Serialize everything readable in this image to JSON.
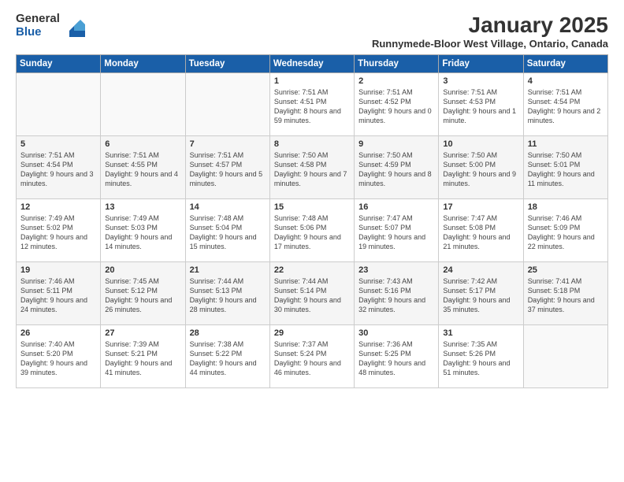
{
  "logo": {
    "general": "General",
    "blue": "Blue"
  },
  "title": "January 2025",
  "location": "Runnymede-Bloor West Village, Ontario, Canada",
  "days_of_week": [
    "Sunday",
    "Monday",
    "Tuesday",
    "Wednesday",
    "Thursday",
    "Friday",
    "Saturday"
  ],
  "weeks": [
    [
      {
        "day": "",
        "info": ""
      },
      {
        "day": "",
        "info": ""
      },
      {
        "day": "",
        "info": ""
      },
      {
        "day": "1",
        "info": "Sunrise: 7:51 AM\nSunset: 4:51 PM\nDaylight: 8 hours and 59 minutes."
      },
      {
        "day": "2",
        "info": "Sunrise: 7:51 AM\nSunset: 4:52 PM\nDaylight: 9 hours and 0 minutes."
      },
      {
        "day": "3",
        "info": "Sunrise: 7:51 AM\nSunset: 4:53 PM\nDaylight: 9 hours and 1 minute."
      },
      {
        "day": "4",
        "info": "Sunrise: 7:51 AM\nSunset: 4:54 PM\nDaylight: 9 hours and 2 minutes."
      }
    ],
    [
      {
        "day": "5",
        "info": "Sunrise: 7:51 AM\nSunset: 4:54 PM\nDaylight: 9 hours and 3 minutes."
      },
      {
        "day": "6",
        "info": "Sunrise: 7:51 AM\nSunset: 4:55 PM\nDaylight: 9 hours and 4 minutes."
      },
      {
        "day": "7",
        "info": "Sunrise: 7:51 AM\nSunset: 4:57 PM\nDaylight: 9 hours and 5 minutes."
      },
      {
        "day": "8",
        "info": "Sunrise: 7:50 AM\nSunset: 4:58 PM\nDaylight: 9 hours and 7 minutes."
      },
      {
        "day": "9",
        "info": "Sunrise: 7:50 AM\nSunset: 4:59 PM\nDaylight: 9 hours and 8 minutes."
      },
      {
        "day": "10",
        "info": "Sunrise: 7:50 AM\nSunset: 5:00 PM\nDaylight: 9 hours and 9 minutes."
      },
      {
        "day": "11",
        "info": "Sunrise: 7:50 AM\nSunset: 5:01 PM\nDaylight: 9 hours and 11 minutes."
      }
    ],
    [
      {
        "day": "12",
        "info": "Sunrise: 7:49 AM\nSunset: 5:02 PM\nDaylight: 9 hours and 12 minutes."
      },
      {
        "day": "13",
        "info": "Sunrise: 7:49 AM\nSunset: 5:03 PM\nDaylight: 9 hours and 14 minutes."
      },
      {
        "day": "14",
        "info": "Sunrise: 7:48 AM\nSunset: 5:04 PM\nDaylight: 9 hours and 15 minutes."
      },
      {
        "day": "15",
        "info": "Sunrise: 7:48 AM\nSunset: 5:06 PM\nDaylight: 9 hours and 17 minutes."
      },
      {
        "day": "16",
        "info": "Sunrise: 7:47 AM\nSunset: 5:07 PM\nDaylight: 9 hours and 19 minutes."
      },
      {
        "day": "17",
        "info": "Sunrise: 7:47 AM\nSunset: 5:08 PM\nDaylight: 9 hours and 21 minutes."
      },
      {
        "day": "18",
        "info": "Sunrise: 7:46 AM\nSunset: 5:09 PM\nDaylight: 9 hours and 22 minutes."
      }
    ],
    [
      {
        "day": "19",
        "info": "Sunrise: 7:46 AM\nSunset: 5:11 PM\nDaylight: 9 hours and 24 minutes."
      },
      {
        "day": "20",
        "info": "Sunrise: 7:45 AM\nSunset: 5:12 PM\nDaylight: 9 hours and 26 minutes."
      },
      {
        "day": "21",
        "info": "Sunrise: 7:44 AM\nSunset: 5:13 PM\nDaylight: 9 hours and 28 minutes."
      },
      {
        "day": "22",
        "info": "Sunrise: 7:44 AM\nSunset: 5:14 PM\nDaylight: 9 hours and 30 minutes."
      },
      {
        "day": "23",
        "info": "Sunrise: 7:43 AM\nSunset: 5:16 PM\nDaylight: 9 hours and 32 minutes."
      },
      {
        "day": "24",
        "info": "Sunrise: 7:42 AM\nSunset: 5:17 PM\nDaylight: 9 hours and 35 minutes."
      },
      {
        "day": "25",
        "info": "Sunrise: 7:41 AM\nSunset: 5:18 PM\nDaylight: 9 hours and 37 minutes."
      }
    ],
    [
      {
        "day": "26",
        "info": "Sunrise: 7:40 AM\nSunset: 5:20 PM\nDaylight: 9 hours and 39 minutes."
      },
      {
        "day": "27",
        "info": "Sunrise: 7:39 AM\nSunset: 5:21 PM\nDaylight: 9 hours and 41 minutes."
      },
      {
        "day": "28",
        "info": "Sunrise: 7:38 AM\nSunset: 5:22 PM\nDaylight: 9 hours and 44 minutes."
      },
      {
        "day": "29",
        "info": "Sunrise: 7:37 AM\nSunset: 5:24 PM\nDaylight: 9 hours and 46 minutes."
      },
      {
        "day": "30",
        "info": "Sunrise: 7:36 AM\nSunset: 5:25 PM\nDaylight: 9 hours and 48 minutes."
      },
      {
        "day": "31",
        "info": "Sunrise: 7:35 AM\nSunset: 5:26 PM\nDaylight: 9 hours and 51 minutes."
      },
      {
        "day": "",
        "info": ""
      }
    ]
  ]
}
